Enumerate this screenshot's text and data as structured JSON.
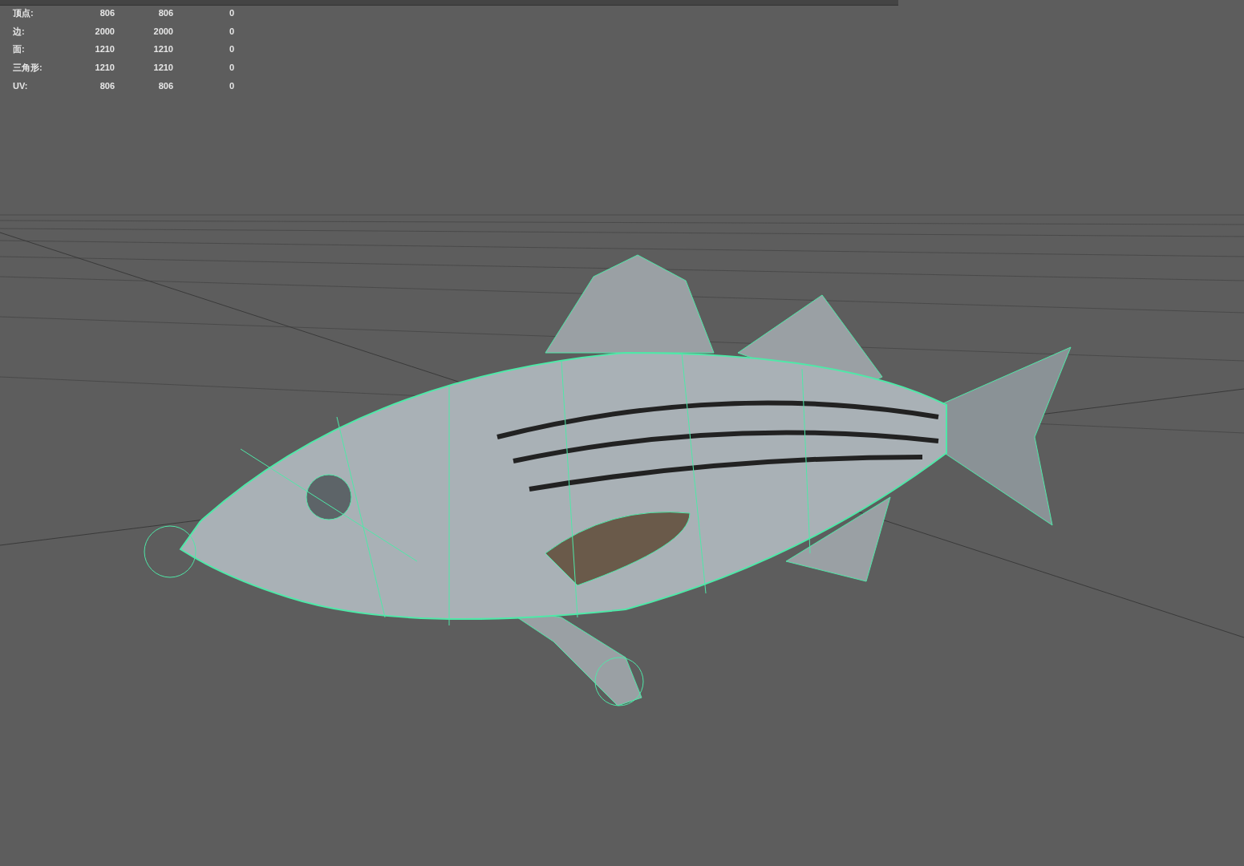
{
  "heads_up_display": {
    "rows": [
      {
        "label": "顶点:",
        "values": [
          "806",
          "806",
          "0"
        ]
      },
      {
        "label": "边:",
        "values": [
          "2000",
          "2000",
          "0"
        ]
      },
      {
        "label": "面:",
        "values": [
          "1210",
          "1210",
          "0"
        ]
      },
      {
        "label": "三角形:",
        "values": [
          "1210",
          "1210",
          "0"
        ]
      },
      {
        "label": "UV:",
        "values": [
          "806",
          "806",
          "0"
        ]
      }
    ]
  }
}
